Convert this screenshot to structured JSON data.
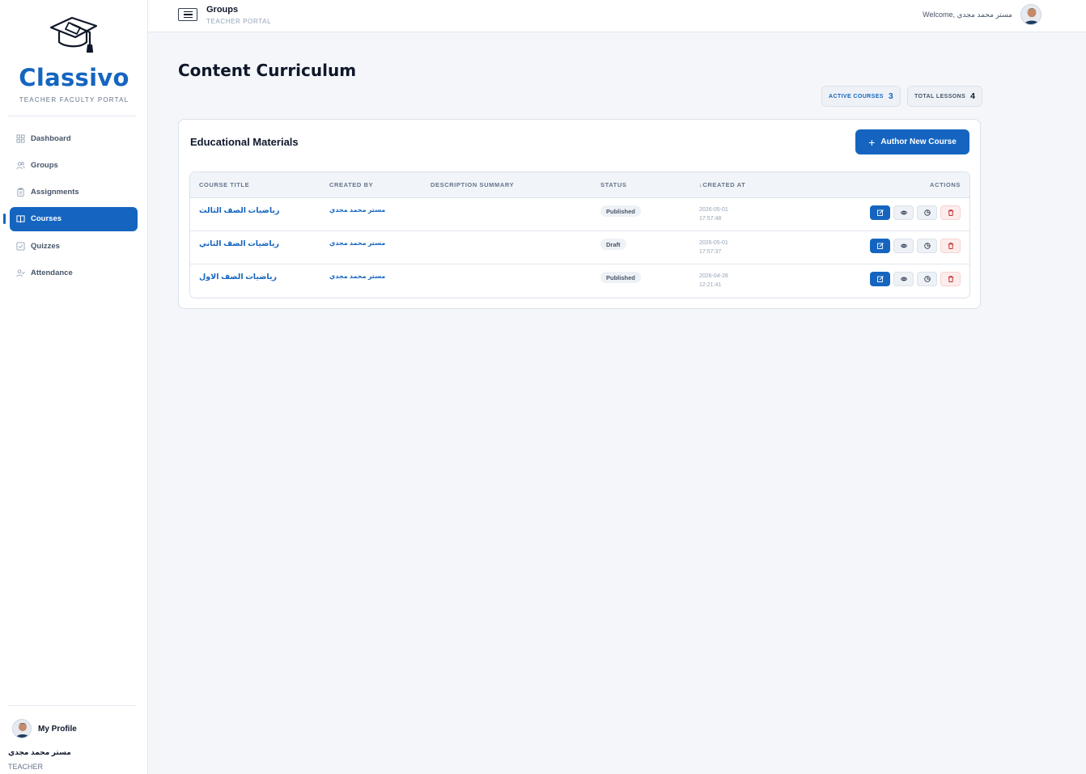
{
  "brand": {
    "name": "Classivo",
    "subtitle": "TEACHER FACULTY PORTAL"
  },
  "sidebar": {
    "items": [
      {
        "label": "Dashboard",
        "icon": "grid-icon",
        "active": false
      },
      {
        "label": "Groups",
        "icon": "users-icon",
        "active": false
      },
      {
        "label": "Assignments",
        "icon": "clipboard-icon",
        "active": false
      },
      {
        "label": "Courses",
        "icon": "book-icon",
        "active": true
      },
      {
        "label": "Quizzes",
        "icon": "checkbox-icon",
        "active": false
      },
      {
        "label": "Attendance",
        "icon": "user-check-icon",
        "active": false
      }
    ],
    "profile": {
      "label": "My Profile",
      "name": "مستر محمد مجدي",
      "role": "TEACHER"
    }
  },
  "topbar": {
    "title": "Groups",
    "subtitle": "TEACHER PORTAL",
    "welcome": "Welcome, مستر محمد مجدي"
  },
  "page": {
    "title": "Content Curriculum",
    "stats": {
      "active_courses_label": "ACTIVE COURSES",
      "active_courses_value": "3",
      "total_lessons_label": "TOTAL LESSONS",
      "total_lessons_value": "4"
    }
  },
  "card": {
    "title": "Educational Materials",
    "author_button": "Author New Course"
  },
  "table": {
    "headers": {
      "course_title": "COURSE TITLE",
      "created_by": "CREATED BY",
      "description": "DESCRIPTION SUMMARY",
      "status": "STATUS",
      "created_at": "↓CREATED AT",
      "actions": "ACTIONS"
    },
    "rows": [
      {
        "title": "رياضيات الصف الثالث",
        "created_by": "مستر محمد مجدي",
        "description": "",
        "status": "Published",
        "date": "2026-05-01",
        "time": "17:57:48"
      },
      {
        "title": "رياضيات الصف الثاني",
        "created_by": "مستر محمد مجدي",
        "description": "",
        "status": "Draft",
        "date": "2026-05-01",
        "time": "17:57:37"
      },
      {
        "title": "رياضيات الصف الاول",
        "created_by": "مستر محمد مجدي",
        "description": "",
        "status": "Published",
        "date": "2026-04-28",
        "time": "12:21:41"
      }
    ]
  },
  "colors": {
    "primary": "#1565c0",
    "background": "#f4f6fa",
    "danger": "#b91c1c"
  }
}
